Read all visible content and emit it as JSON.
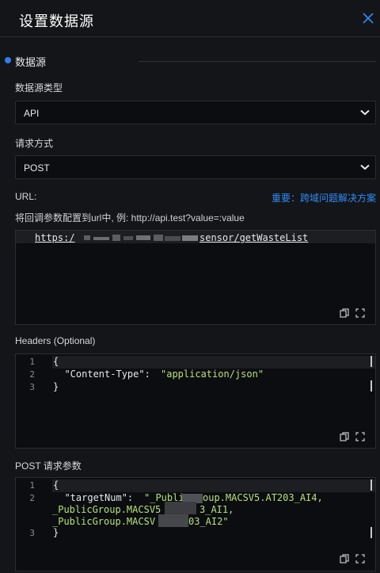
{
  "header": {
    "title": "设置数据源"
  },
  "section": {
    "title": "数据源"
  },
  "source_type": {
    "label": "数据源类型",
    "value": "API"
  },
  "method": {
    "label": "请求方式",
    "value": "POST"
  },
  "url": {
    "label": "URL:",
    "help_link": "重要：跨域问题解决方案",
    "hint": "将回调参数配置到url中, 例: http://api.test?value=:value",
    "value_prefix": "https:/",
    "value_suffix": "sensor/getWasteList"
  },
  "headers": {
    "label": "Headers (Optional)",
    "line_numbers": [
      "1",
      "2",
      "3"
    ],
    "lines": {
      "l1": "{",
      "l2_key": "  \"Content-Type\": ",
      "l2_val": "\"application/json\"",
      "l3": "}"
    }
  },
  "post_params": {
    "label": "POST 请求参数",
    "line_numbers": [
      "1",
      "2",
      "",
      "",
      "3"
    ],
    "lines": {
      "l1": "{",
      "l2_key": "  \"targetNum\": ",
      "l2_val_a": "\"_Publi",
      "l2_val_b": "oup.MACSV5.AT203_AI4,",
      "l2b_a": "_PublicGroup.MACSV5",
      "l2b_b": "3_AI1,",
      "l2c_a": "_PublicGroup.MACSV",
      "l2c_b": "03_AI2\"",
      "l3": "}"
    }
  },
  "colors": {
    "accent": "#2f80ed",
    "link": "#2f8cf4",
    "string": "#b5e17a",
    "background": "#141519",
    "input_bg": "#0c0d10"
  },
  "icons": [
    "close-icon",
    "caret-down-icon",
    "copy-icon",
    "fullscreen-icon"
  ]
}
